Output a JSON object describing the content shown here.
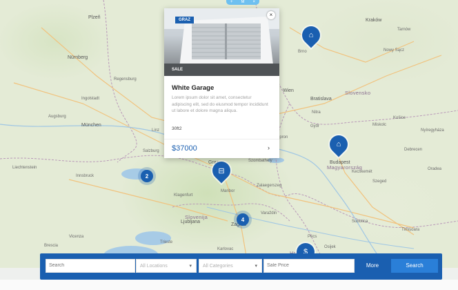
{
  "map": {
    "countries": [
      "Slovenija",
      "Magyarország",
      "Slovensko",
      "Hrvatska"
    ],
    "places": [
      {
        "name": "Plzeň",
        "big": true
      },
      {
        "name": "Nürnberg",
        "big": true
      },
      {
        "name": "München",
        "big": true
      },
      {
        "name": "Regensburg"
      },
      {
        "name": "Augsburg"
      },
      {
        "name": "Ingolstadt"
      },
      {
        "name": "Wien",
        "big": true
      },
      {
        "name": "Bratislava",
        "big": true
      },
      {
        "name": "Budapest",
        "big": true
      },
      {
        "name": "Graz",
        "big": true
      },
      {
        "name": "Ljubljana",
        "big": true
      },
      {
        "name": "Zagreb",
        "big": true
      },
      {
        "name": "Maribor"
      },
      {
        "name": "Salzburg"
      },
      {
        "name": "Innsbruck"
      },
      {
        "name": "Klagenfurt"
      },
      {
        "name": "Linz"
      },
      {
        "name": "Brno"
      },
      {
        "name": "Kraków",
        "big": true
      },
      {
        "name": "Košice"
      },
      {
        "name": "Győr"
      },
      {
        "name": "Szombathely"
      },
      {
        "name": "Pécs"
      },
      {
        "name": "Szeged"
      },
      {
        "name": "Debrecen"
      },
      {
        "name": "Oradea"
      },
      {
        "name": "Timișoara"
      },
      {
        "name": "Osijek"
      },
      {
        "name": "Trieste"
      },
      {
        "name": "Karlovac"
      },
      {
        "name": "Nitra"
      },
      {
        "name": "Tarnów"
      },
      {
        "name": "Nowy Sącz"
      },
      {
        "name": "Miskolc"
      },
      {
        "name": "Liechtenstein"
      },
      {
        "name": "Varaždin"
      },
      {
        "name": "Vicenza"
      },
      {
        "name": "Brescia"
      },
      {
        "name": "Sopron"
      },
      {
        "name": "Kecskemét"
      },
      {
        "name": "Nyíregyháza"
      },
      {
        "name": "Zalaegerszeg"
      },
      {
        "name": "Subotica"
      }
    ],
    "clusters": [
      {
        "count": "2"
      },
      {
        "count": "4"
      }
    ],
    "pins": [
      {
        "icon": "home-icon",
        "glyph": "⌂"
      },
      {
        "icon": "home-icon",
        "glyph": "⌂"
      },
      {
        "icon": "garage-icon",
        "glyph": "⊟"
      },
      {
        "icon": "dollar-icon",
        "glyph": "$"
      }
    ]
  },
  "top_toggle": {
    "plus": "+",
    "label": "M",
    "close": "×"
  },
  "card": {
    "city_badge": "GRAZ",
    "sale_badge": "SALE",
    "close": "×",
    "title": "White Garage",
    "description": "Lorem ipsum dolor sit amet, consectetur adipiscing elit, sed do eiusmod tempor incididunt ut labore et dolore magna aliqua.",
    "area": "30ft2",
    "price": "$37000",
    "arrow": "›"
  },
  "search": {
    "keyword_placeholder": "Search",
    "location_value": "All Locations",
    "category_value": "All Categories",
    "price_placeholder": "Sale Price",
    "more_label": "More",
    "search_label": "Search"
  },
  "colors": {
    "accent": "#1a5fb0",
    "toggle": "#6ec0f0"
  }
}
